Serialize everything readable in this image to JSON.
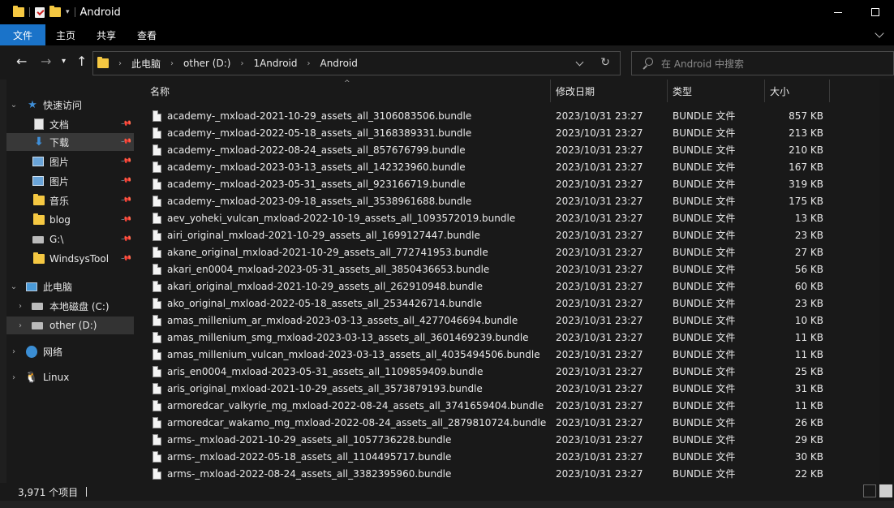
{
  "window": {
    "title": "Android"
  },
  "ribbon": {
    "tabs": [
      "文件",
      "主页",
      "共享",
      "查看"
    ]
  },
  "address": {
    "crumbs": [
      "此电脑",
      "other (D:)",
      "1Android",
      "Android"
    ]
  },
  "search": {
    "placeholder": "在 Android 中搜索"
  },
  "nav": {
    "quick_access": "快速访问",
    "items": [
      {
        "label": "文档",
        "icon": "document-icon",
        "pinned": true
      },
      {
        "label": "下载",
        "icon": "download-icon",
        "pinned": true
      },
      {
        "label": "图片",
        "icon": "picture-icon",
        "pinned": true
      },
      {
        "label": "图片",
        "icon": "picture-icon",
        "pinned": true
      },
      {
        "label": "音乐",
        "icon": "folder-icon",
        "pinned": true
      },
      {
        "label": "blog",
        "icon": "folder-icon",
        "pinned": true
      },
      {
        "label": "G:\\",
        "icon": "network-drive-icon",
        "pinned": true
      },
      {
        "label": "WindsysTool",
        "icon": "folder-icon",
        "pinned": true
      }
    ],
    "this_pc": "此电脑",
    "drives": [
      {
        "label": "本地磁盘 (C:)"
      },
      {
        "label": "other (D:)"
      }
    ],
    "network": "网络",
    "linux": "Linux"
  },
  "columns": {
    "name": "名称",
    "date": "修改日期",
    "type": "类型",
    "size": "大小"
  },
  "files": [
    {
      "name": "academy-_mxload-2021-10-29_assets_all_3106083506.bundle",
      "date": "2023/10/31 23:27",
      "type": "BUNDLE 文件",
      "size": "857 KB"
    },
    {
      "name": "academy-_mxload-2022-05-18_assets_all_3168389331.bundle",
      "date": "2023/10/31 23:27",
      "type": "BUNDLE 文件",
      "size": "213 KB"
    },
    {
      "name": "academy-_mxload-2022-08-24_assets_all_857676799.bundle",
      "date": "2023/10/31 23:27",
      "type": "BUNDLE 文件",
      "size": "210 KB"
    },
    {
      "name": "academy-_mxload-2023-03-13_assets_all_142323960.bundle",
      "date": "2023/10/31 23:27",
      "type": "BUNDLE 文件",
      "size": "167 KB"
    },
    {
      "name": "academy-_mxload-2023-05-31_assets_all_923166719.bundle",
      "date": "2023/10/31 23:27",
      "type": "BUNDLE 文件",
      "size": "319 KB"
    },
    {
      "name": "academy-_mxload-2023-09-18_assets_all_3538961688.bundle",
      "date": "2023/10/31 23:27",
      "type": "BUNDLE 文件",
      "size": "175 KB"
    },
    {
      "name": "aev_yoheki_vulcan_mxload-2022-10-19_assets_all_1093572019.bundle",
      "date": "2023/10/31 23:27",
      "type": "BUNDLE 文件",
      "size": "13 KB"
    },
    {
      "name": "airi_original_mxload-2021-10-29_assets_all_1699127447.bundle",
      "date": "2023/10/31 23:27",
      "type": "BUNDLE 文件",
      "size": "23 KB"
    },
    {
      "name": "akane_original_mxload-2021-10-29_assets_all_772741953.bundle",
      "date": "2023/10/31 23:27",
      "type": "BUNDLE 文件",
      "size": "27 KB"
    },
    {
      "name": "akari_en0004_mxload-2023-05-31_assets_all_3850436653.bundle",
      "date": "2023/10/31 23:27",
      "type": "BUNDLE 文件",
      "size": "56 KB"
    },
    {
      "name": "akari_original_mxload-2021-10-29_assets_all_262910948.bundle",
      "date": "2023/10/31 23:27",
      "type": "BUNDLE 文件",
      "size": "60 KB"
    },
    {
      "name": "ako_original_mxload-2022-05-18_assets_all_2534426714.bundle",
      "date": "2023/10/31 23:27",
      "type": "BUNDLE 文件",
      "size": "23 KB"
    },
    {
      "name": "amas_millenium_ar_mxload-2023-03-13_assets_all_4277046694.bundle",
      "date": "2023/10/31 23:27",
      "type": "BUNDLE 文件",
      "size": "10 KB"
    },
    {
      "name": "amas_millenium_smg_mxload-2023-03-13_assets_all_3601469239.bundle",
      "date": "2023/10/31 23:27",
      "type": "BUNDLE 文件",
      "size": "11 KB"
    },
    {
      "name": "amas_millenium_vulcan_mxload-2023-03-13_assets_all_4035494506.bundle",
      "date": "2023/10/31 23:27",
      "type": "BUNDLE 文件",
      "size": "11 KB"
    },
    {
      "name": "aris_en0004_mxload-2023-05-31_assets_all_1109859409.bundle",
      "date": "2023/10/31 23:27",
      "type": "BUNDLE 文件",
      "size": "25 KB"
    },
    {
      "name": "aris_original_mxload-2021-10-29_assets_all_3573879193.bundle",
      "date": "2023/10/31 23:27",
      "type": "BUNDLE 文件",
      "size": "31 KB"
    },
    {
      "name": "armoredcar_valkyrie_mg_mxload-2022-08-24_assets_all_3741659404.bundle",
      "date": "2023/10/31 23:27",
      "type": "BUNDLE 文件",
      "size": "11 KB"
    },
    {
      "name": "armoredcar_wakamo_mg_mxload-2022-08-24_assets_all_2879810724.bundle",
      "date": "2023/10/31 23:27",
      "type": "BUNDLE 文件",
      "size": "26 KB"
    },
    {
      "name": "arms-_mxload-2021-10-29_assets_all_1057736228.bundle",
      "date": "2023/10/31 23:27",
      "type": "BUNDLE 文件",
      "size": "29 KB"
    },
    {
      "name": "arms-_mxload-2022-05-18_assets_all_1104495717.bundle",
      "date": "2023/10/31 23:27",
      "type": "BUNDLE 文件",
      "size": "30 KB"
    },
    {
      "name": "arms-_mxload-2022-08-24_assets_all_3382395960.bundle",
      "date": "2023/10/31 23:27",
      "type": "BUNDLE 文件",
      "size": "22 KB"
    }
  ],
  "status": {
    "count": "3,971 个项目"
  },
  "colors": {
    "accent": "#1a73c9",
    "background": "#191919",
    "titlebar": "#000000"
  }
}
